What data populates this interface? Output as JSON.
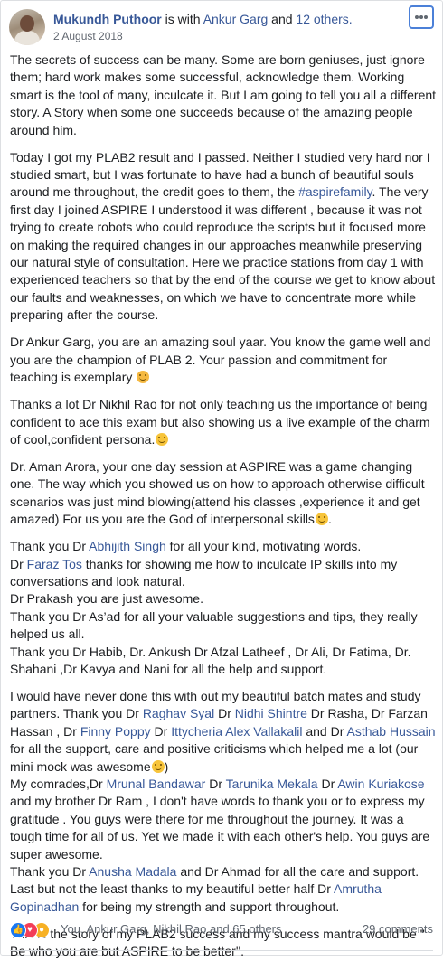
{
  "header": {
    "name": "Mukundh Puthoor",
    "with_text": "is with",
    "tagged": "Ankur Garg",
    "and_text": "and",
    "others": "12 others.",
    "date": "2 August 2018"
  },
  "post": {
    "p1": "The secrets of success can be many. Some are born geniuses, just ignore them; hard work makes some successful, acknowledge them. Working smart is the tool of many, inculcate it. But I am going to tell you all a different story. A Story when some one succeeds because of the amazing people around him.",
    "p2a": "Today I got my PLAB2 result and I passed. Neither I studied very hard nor I studied smart, but I was fortunate to have had a bunch of beautiful souls around me throughout, the credit goes to them, the ",
    "hashtag": "#aspirefamily",
    "p2b": ". The very first day I joined ASPIRE I understood it was different , because it was not trying to create robots who could reproduce the scripts but it focused more on making the required changes in our approaches meanwhile preserving our natural style of consultation. Here we practice stations from day 1 with experienced teachers so that by the end of the course we get to know about our faults and weaknesses, on which we have to concentrate more while preparing after the course.",
    "p3": "Dr Ankur Garg, you are an amazing soul yaar. You know the game well and you are the champion of PLAB 2. Your passion and commitment for teaching is exemplary ",
    "p4": "Thanks a lot Dr Nikhil Rao for not only teaching us the importance of being confident to ace this exam but also showing us a live example of the charm of cool,confident persona.",
    "p5": "Dr. Aman Arora, your one day session at ASPIRE was a game changing one. The way which you showed us on how to approach otherwise difficult scenarios was just mind blowing(attend his classes ,experience it and get amazed) For us you are the God of interpersonal skills",
    "p6": {
      "t1": "Thank you Dr ",
      "abhijith": "Abhijith Singh",
      "t2": " for all your kind, motivating words.",
      "t3": "Dr ",
      "faraz": "Faraz Tos",
      "t4": " thanks for showing me how to inculcate IP skills into my conversations and look natural.",
      "t5": "Dr Prakash you are just awesome.",
      "t6": "Thank you Dr As’ad for all your valuable suggestions and tips, they really helped us all.",
      "t7": "Thank you Dr Habib, Dr. Ankush Dr Afzal Latheef , Dr Ali, Dr Fatima, Dr. Shahani ,Dr Kavya and Nani for all the help and support."
    },
    "p7": {
      "t1": "I would have never done this with out my beautiful batch mates and study partners. Thank you Dr ",
      "raghav": "Raghav Syal",
      "t2": " Dr ",
      "nidhi": "Nidhi Shintre",
      "t3": " Dr Rasha, Dr Farzan Hassan , Dr ",
      "finny": "Finny Poppy",
      "t4": " Dr ",
      "ittycheria": "Ittycheria Alex Vallakalil",
      "t5": " and Dr ",
      "asthab": "Asthab Hussain",
      "t6": " for all the support, care and positive criticisms which helped me a lot (our mini mock was awesome",
      "t7": ")",
      "t8": "My comrades,Dr ",
      "mrunal": "Mrunal Bandawar",
      "t9": " Dr ",
      "tarunika": "Tarunika Mekala",
      "t10": " Dr ",
      "awin": "Awin Kuriakose",
      "t11": " and my brother Dr Ram , I don't have words to thank you or to express my gratitude . You guys were there for me throughout the journey. It was a tough time for all of us. Yet we made it with each other's help. You guys are super awesome.",
      "t12": "Thank you Dr ",
      "anusha": "Anusha Madala",
      "t13": " and Dr Ahmad for all the care and support.",
      "t14": "Last but not the least thanks to my beautiful better half Dr ",
      "amrutha": "Amrutha Gopinadhan",
      "t15": " for being my strength and support throughout."
    },
    "p8": "This is the story of my PLAB2 success and my success mantra would be '' Be who you are but ASPIRE to be better''."
  },
  "footer": {
    "reaction_text": "You, Ankur Garg, Nikhil Rao and 65 others",
    "comments": "29 comments"
  },
  "colors": {
    "link": "#385898",
    "text": "#1c1e21",
    "muted": "#606770",
    "like": "#1877f2",
    "love": "#f33e58",
    "wow": "#f7b125"
  }
}
